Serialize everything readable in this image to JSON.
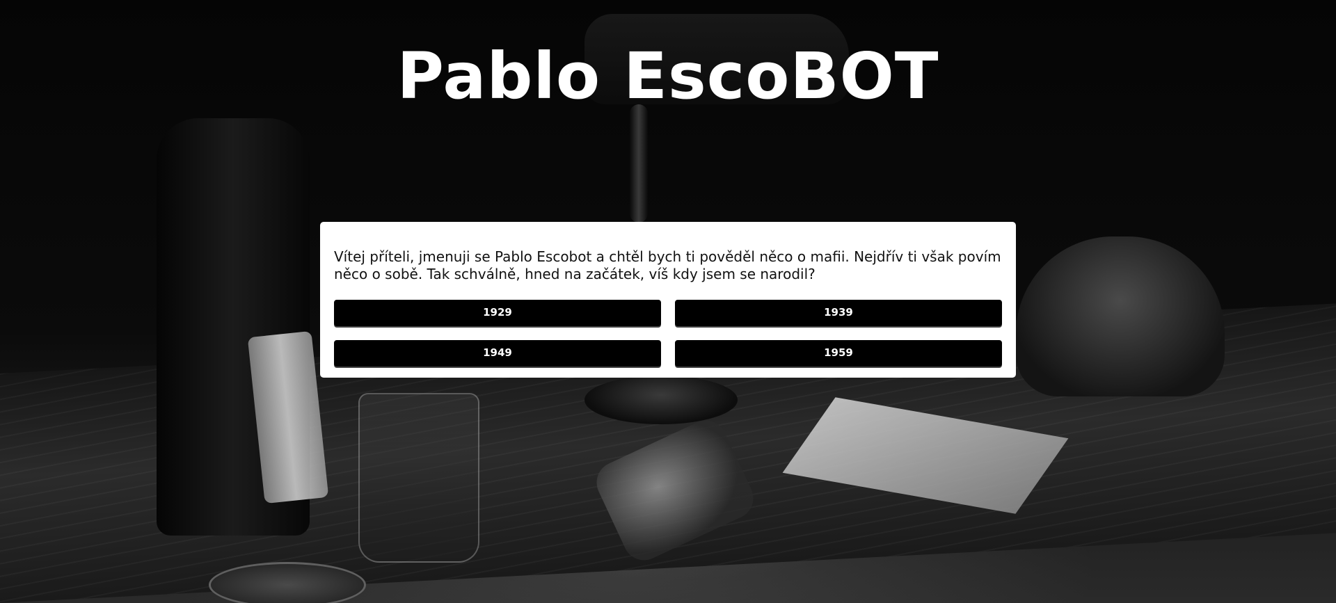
{
  "header": {
    "title": "Pablo EscoBOT"
  },
  "quiz": {
    "question": "Vítej příteli, jmenuji se Pablo Escobot a chtěl bych ti pověděl něco o mafii. Nejdřív ti však povím něco o sobě. Tak schválně, hned na začátek, víš kdy jsem se narodil?",
    "answers": [
      "1929",
      "1939",
      "1949",
      "1959"
    ]
  }
}
